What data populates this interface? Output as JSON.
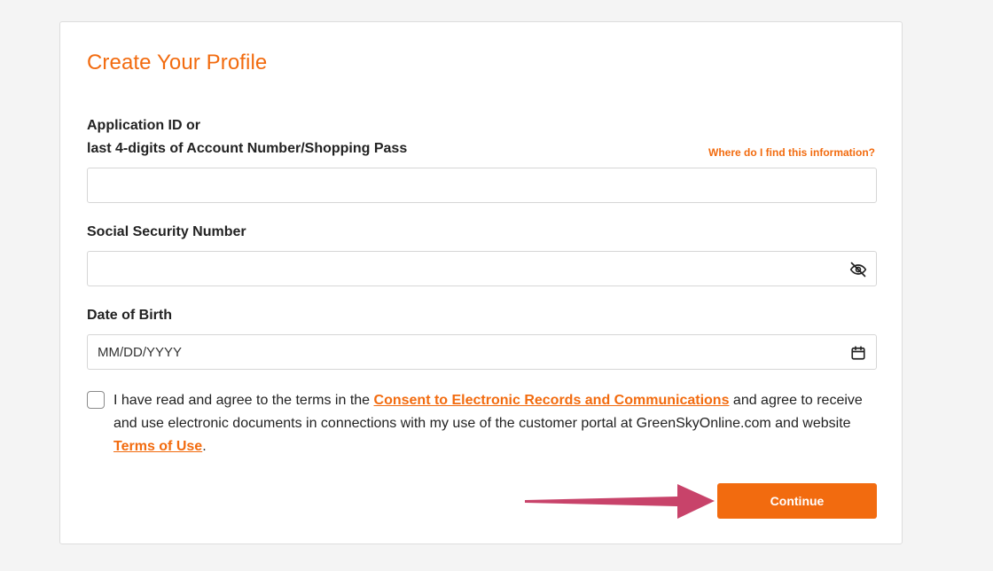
{
  "form": {
    "title": "Create Your Profile",
    "app_id": {
      "label_line1": "Application ID or",
      "label_line2": "last 4-digits of Account Number/Shopping Pass",
      "help_link": "Where do I find this information?",
      "value": "",
      "placeholder": ""
    },
    "ssn": {
      "label": "Social Security Number",
      "value": "",
      "placeholder": "",
      "toggle_icon": "eye-slash-icon"
    },
    "dob": {
      "label": "Date of Birth",
      "value": "",
      "placeholder": "MM/DD/YYYY",
      "icon": "calendar-icon"
    },
    "consent": {
      "checked": false,
      "text_before": "I have read and agree to the terms in the ",
      "link1": "Consent to Electronic Records and Communications",
      "text_middle": " and agree to receive and use electronic documents in connections with my use of the customer portal at GreenSkyOnline.com and website ",
      "link2": "Terms of Use",
      "text_after": "."
    },
    "continue_label": "Continue"
  },
  "colors": {
    "accent": "#f26b0f",
    "annotation_arrow": "#c8436a"
  }
}
